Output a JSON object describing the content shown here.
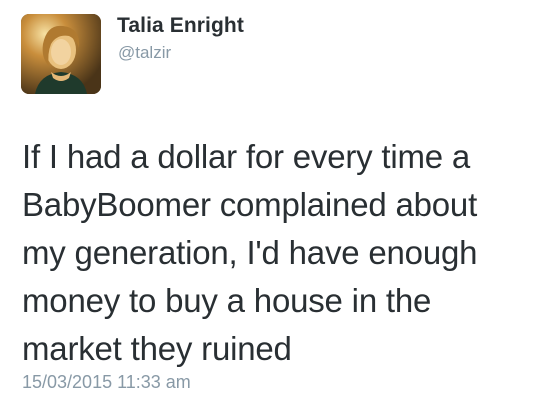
{
  "author": {
    "display_name": "Talia Enright",
    "handle": "@talzir",
    "avatar_icon": "profile-photo"
  },
  "tweet": {
    "text": "If I had a dollar for every time a\nBabyBoomer complained about\nmy generation, I'd have enough\nmoney to buy a house in the\nmarket they ruined",
    "timestamp": "15/03/2015 11:33 am"
  },
  "colors": {
    "name": "#292f33",
    "secondary": "#8899a6",
    "background": "#ffffff"
  }
}
